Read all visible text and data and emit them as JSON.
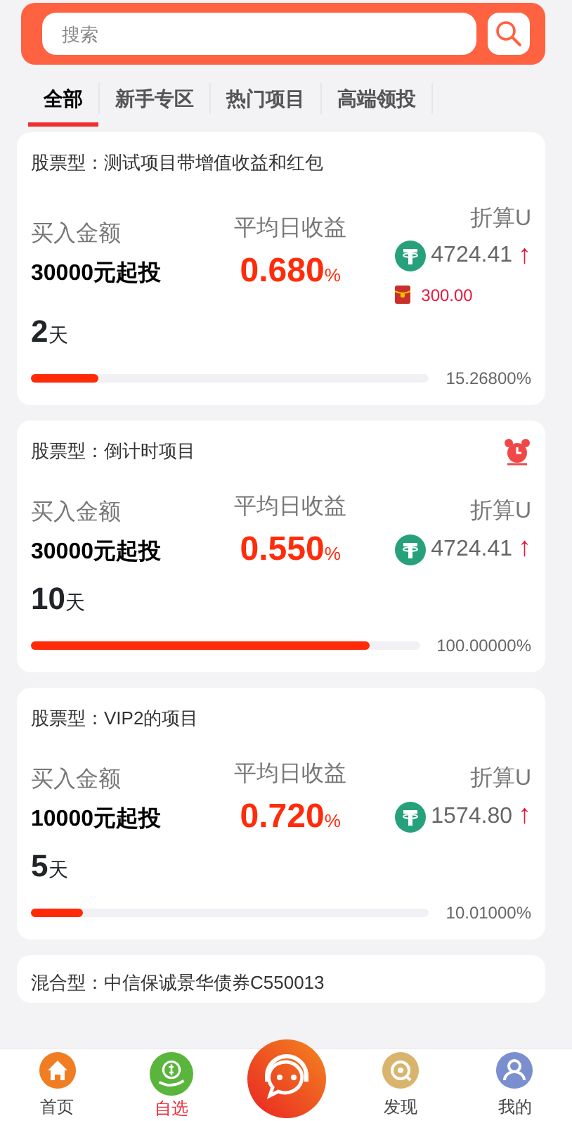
{
  "search": {
    "placeholder": "搜索"
  },
  "tabs": [
    {
      "label": "全部",
      "selected": true
    },
    {
      "label": "新手专区",
      "selected": false
    },
    {
      "label": "热门项目",
      "selected": false
    },
    {
      "label": "高端领投",
      "selected": false
    }
  ],
  "products": [
    {
      "title": "股票型：测试项目带增值收益和红包",
      "alarm": false,
      "buy_label": "买入金额",
      "amount": "30000元起投",
      "rate_label": "平均日收益",
      "rate": "0.680",
      "rate_unit": "%",
      "convert_label": "折算U",
      "usdt": "4724.41",
      "trend": "↑",
      "bonus": "300.00",
      "days": "2",
      "days_unit": "天",
      "level": 0.17,
      "progress": "15.26800%"
    },
    {
      "title": "股票型：倒计时项目",
      "alarm": true,
      "buy_label": "买入金额",
      "amount": "30000元起投",
      "rate_label": "平均日收益",
      "rate": "0.550",
      "rate_unit": "%",
      "convert_label": "折算U",
      "usdt": "4724.41",
      "trend": "↑",
      "days": "10",
      "days_unit": "天",
      "level": 0.87,
      "progress": "100.00000%"
    },
    {
      "title": "股票型：VIP2的项目",
      "alarm": false,
      "buy_label": "买入金额",
      "amount": "10000元起投",
      "rate_label": "平均日收益",
      "rate": "0.720",
      "rate_unit": "%",
      "convert_label": "折算U",
      "usdt": "1574.80",
      "trend": "↑",
      "days": "5",
      "days_unit": "天",
      "level": 0.13,
      "progress": "10.01000%"
    },
    {
      "title": "混合型：中信保诚景华债券C550013"
    }
  ],
  "bottom_nav": [
    {
      "kind": "home",
      "label": "首页",
      "selected": false
    },
    {
      "kind": "wallet",
      "label": "自选",
      "selected": true
    },
    {
      "kind": "service"
    },
    {
      "kind": "discover",
      "label": "发现",
      "selected": false
    },
    {
      "kind": "profile",
      "label": "我的",
      "selected": false
    }
  ]
}
